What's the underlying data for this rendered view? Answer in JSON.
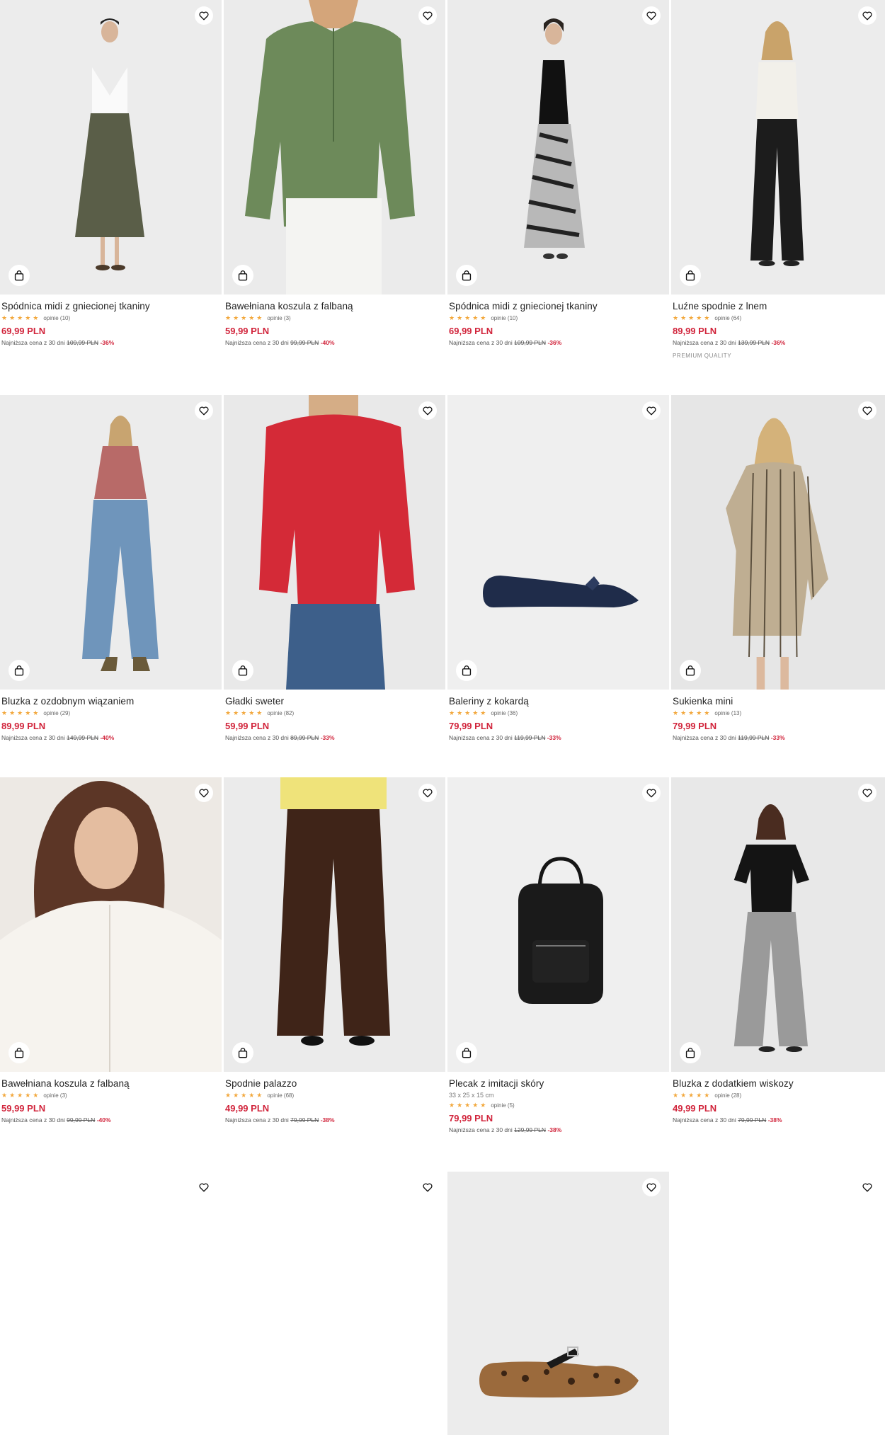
{
  "colors": {
    "price": "#d1243b",
    "stars": "#f2a73b",
    "photo_bg": "#ececec"
  },
  "icons": {
    "favorite": "heart-icon",
    "cart": "shopping-bag-icon"
  },
  "products": [
    {
      "name": "Spódnica midi z gniecionej tkaniny",
      "stars": "★★★★★",
      "reviews": "opinie (10)",
      "price": "69,99 PLN",
      "lowest_label": "Najniższa cena z 30 dni",
      "old_price": "109,99 PLN",
      "discount": "-36%"
    },
    {
      "name": "Bawełniana koszula z falbaną",
      "stars": "★★★★★",
      "reviews": "opinie (3)",
      "price": "59,99 PLN",
      "lowest_label": "Najniższa cena z 30 dni",
      "old_price": "99,99 PLN",
      "discount": "-40%"
    },
    {
      "name": "Spódnica midi z gniecionej tkaniny",
      "stars": "★★★★★",
      "reviews": "opinie (10)",
      "price": "69,99 PLN",
      "lowest_label": "Najniższa cena z 30 dni",
      "old_price": "109,99 PLN",
      "discount": "-36%"
    },
    {
      "name": "Luźne spodnie z lnem",
      "stars": "★★★★★",
      "reviews": "opinie (64)",
      "price": "89,99 PLN",
      "lowest_label": "Najniższa cena z 30 dni",
      "old_price": "139,99 PLN",
      "discount": "-36%",
      "badge": "PREMIUM QUALITY"
    },
    {
      "name": "Bluzka z ozdobnym wiązaniem",
      "stars": "★★★★★",
      "reviews": "opinie (29)",
      "price": "89,99 PLN",
      "lowest_label": "Najniższa cena z 30 dni",
      "old_price": "149,99 PLN",
      "discount": "-40%"
    },
    {
      "name": "Gładki sweter",
      "stars": "★★★★★",
      "reviews": "opinie (82)",
      "price": "59,99 PLN",
      "lowest_label": "Najniższa cena z 30 dni",
      "old_price": "89,99 PLN",
      "discount": "-33%"
    },
    {
      "name": "Baleriny z kokardą",
      "stars": "★★★★★",
      "reviews": "opinie (36)",
      "price": "79,99 PLN",
      "lowest_label": "Najniższa cena z 30 dni",
      "old_price": "119,99 PLN",
      "discount": "-33%"
    },
    {
      "name": "Sukienka mini",
      "stars": "★★★★★",
      "reviews": "opinie (13)",
      "price": "79,99 PLN",
      "lowest_label": "Najniższa cena z 30 dni",
      "old_price": "119,99 PLN",
      "discount": "-33%"
    },
    {
      "name": "Bawełniana koszula z falbaną",
      "stars": "★★★★★",
      "reviews": "opinie (3)",
      "price": "59,99 PLN",
      "lowest_label": "Najniższa cena z 30 dni",
      "old_price": "99,99 PLN",
      "discount": "-40%"
    },
    {
      "name": "Spodnie palazzo",
      "stars": "★★★★★",
      "reviews": "opinie (68)",
      "price": "49,99 PLN",
      "lowest_label": "Najniższa cena z 30 dni",
      "old_price": "79,99 PLN",
      "discount": "-38%"
    },
    {
      "name": "Plecak z imitacji skóry",
      "dims": "33 x 25 x 15 cm",
      "stars": "★★★★★",
      "reviews": "opinie (5)",
      "price": "79,99 PLN",
      "lowest_label": "Najniższa cena z 30 dni",
      "old_price": "129,99 PLN",
      "discount": "-38%"
    },
    {
      "name": "Bluzka z dodatkiem wiskozy",
      "stars": "★★★★★",
      "reviews": "opinie (28)",
      "price": "49,99 PLN",
      "lowest_label": "Najniższa cena z 30 dni",
      "old_price": "79,99 PLN",
      "discount": "-38%"
    }
  ]
}
